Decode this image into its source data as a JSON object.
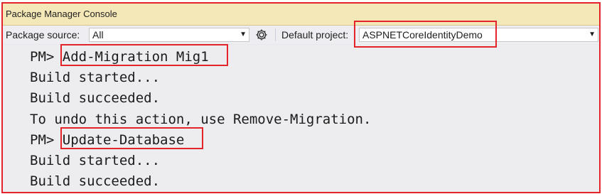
{
  "window": {
    "title": "Package Manager Console"
  },
  "toolbar": {
    "package_source_label": "Package source:",
    "package_source_value": "All",
    "settings_icon": "gear-icon",
    "default_project_label": "Default project:",
    "default_project_value": "ASPNETCoreIdentityDemo"
  },
  "console": {
    "lines": [
      {
        "prompt": "PM>",
        "text": "Add-Migration Mig1"
      },
      {
        "prompt": "",
        "text": "Build started..."
      },
      {
        "prompt": "",
        "text": "Build succeeded."
      },
      {
        "prompt": "",
        "text": "To undo this action, use Remove-Migration."
      },
      {
        "prompt": "PM>",
        "text": "Update-Database"
      },
      {
        "prompt": "",
        "text": "Build started..."
      },
      {
        "prompt": "",
        "text": "Build succeeded."
      }
    ]
  },
  "colors": {
    "highlight_border": "#e3242b",
    "title_bar_bg": "#f5e8b8",
    "console_bg": "#ededf0"
  }
}
